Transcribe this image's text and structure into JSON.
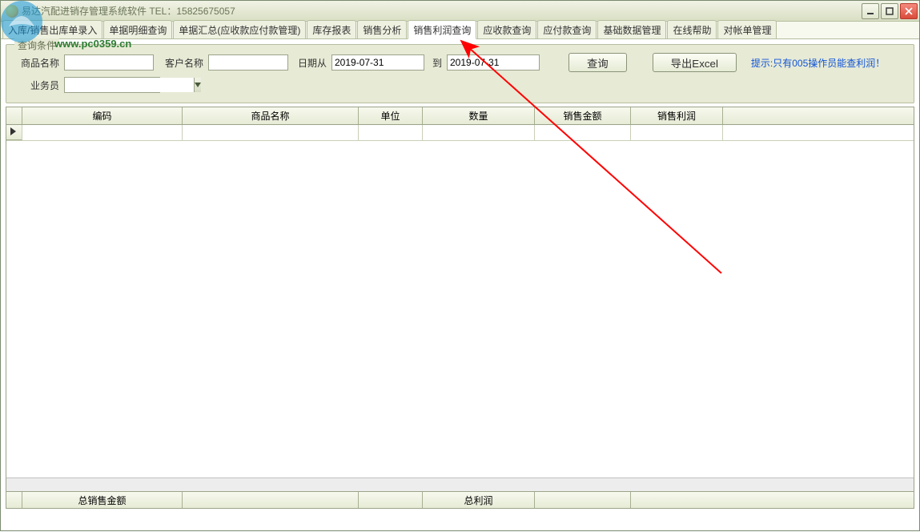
{
  "title": "易达汽配进销存管理系统软件 TEL：15825675057",
  "watermark": {
    "url": "www.pc0359.cn"
  },
  "tabs": [
    {
      "label": "入库/销售出库单录入"
    },
    {
      "label": "单据明细查询"
    },
    {
      "label": "单据汇总(应收款应付款管理)"
    },
    {
      "label": "库存报表"
    },
    {
      "label": "销售分析"
    },
    {
      "label": "销售利润查询"
    },
    {
      "label": "应收款查询"
    },
    {
      "label": "应付款查询"
    },
    {
      "label": "基础数据管理"
    },
    {
      "label": "在线帮助"
    },
    {
      "label": "对帐单管理"
    }
  ],
  "active_tab_index": 5,
  "filter": {
    "legend": "查询条件",
    "product_label": "商品名称",
    "product_value": "",
    "customer_label": "客户名称",
    "customer_value": "",
    "date_from_label": "日期从",
    "date_from": "2019-07-31",
    "date_to_label": "到",
    "date_to": "2019-07-31",
    "query_btn": "查询",
    "export_btn": "导出Excel",
    "hint": "提示:只有005操作员能查利润！",
    "salesman_label": "业务员",
    "salesman_value": ""
  },
  "grid": {
    "columns": [
      "编码",
      "商品名称",
      "单位",
      "数量",
      "销售金额",
      "销售利润"
    ],
    "rows": []
  },
  "footer": {
    "total_sales_label": "总销售金额",
    "total_profit_label": "总利润"
  }
}
